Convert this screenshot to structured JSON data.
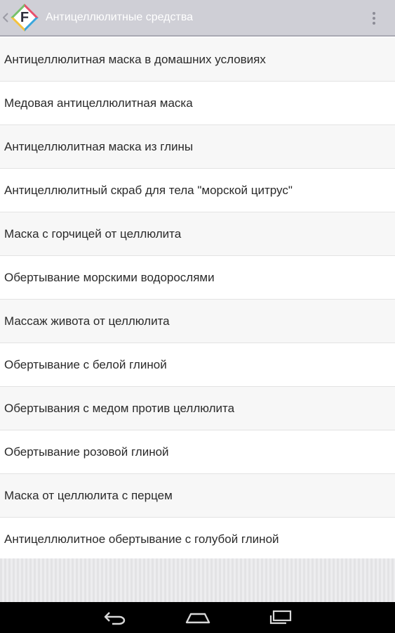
{
  "header": {
    "logo_letter": "F",
    "title": "Антицеллюлитные средства"
  },
  "list": {
    "items": [
      "Антицеллюлитная маска в домашних условиях",
      "Медовая антицеллюлитная маска",
      "Антицеллюлитная маска из глины",
      "Антицеллюлитный скраб для тела \"морской цитрус\"",
      "Маска с горчицей от целлюлита",
      "Обертывание морскими водорослями",
      "Массаж живота от целлюлита",
      "Обертывание с белой глиной",
      "Обертывания с медом против целлюлита",
      "Обертывание розовой глиной",
      "Маска от целлюлита с перцем",
      "Антицеллюлитное обертывание с голубой глиной"
    ]
  },
  "icons": {
    "up": "chevron-left-icon",
    "overflow": "more-vert-icon",
    "nav": [
      "back-icon",
      "home-icon",
      "recents-icon"
    ]
  },
  "colors": {
    "action_bar": "#cfcfd6",
    "title_text": "#ffffff",
    "nav_bar": "#000000"
  }
}
